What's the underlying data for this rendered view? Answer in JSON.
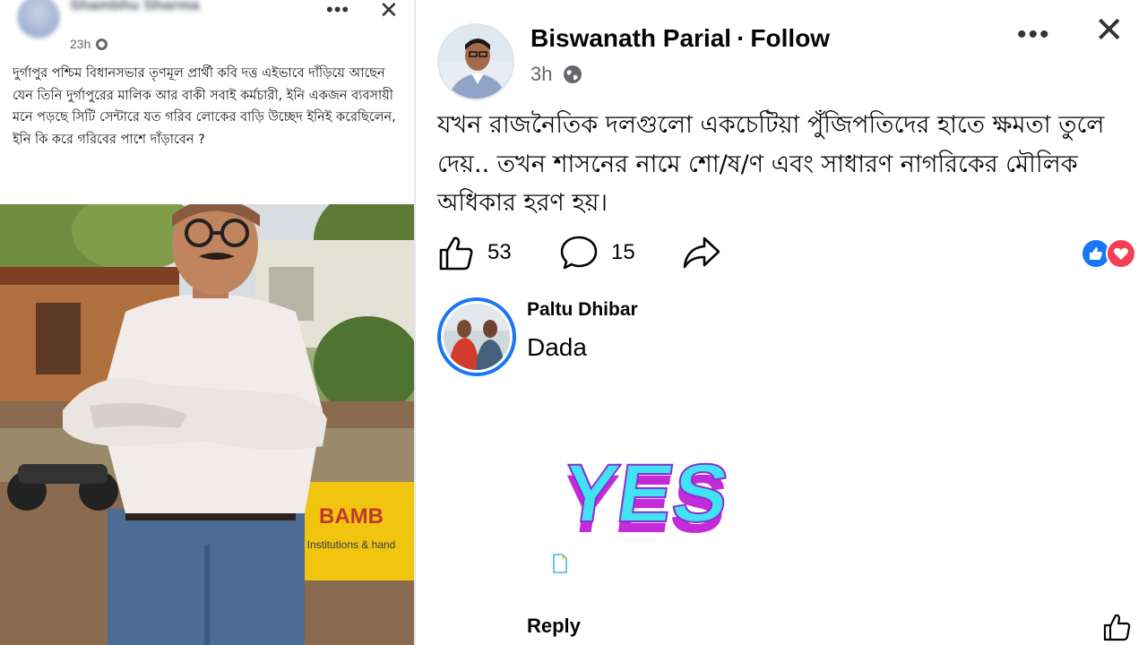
{
  "left_post": {
    "author_name": "Shambhu Sharma",
    "timestamp": "23h",
    "more_label": "•••",
    "close_label": "✕",
    "text": "দুর্গাপুর পশ্চিম বিধানসভার তৃণমূল প্রার্থী কবি দত্ত এইভাবে দাঁড়িয়ে আছেন যেন তিনি দুর্গাপুরের মালিক আর বাকী সবাই কর্মচারী, ইনি একজন ব্যবসায়ী মনে পড়ছে সিটি সেন্টারে যত গরিব লোকের বাড়ি উচ্ছেদ ইনিই করেছিলেন, ইনি কি করে গরিবের পাশে দাঁড়াবেন ?",
    "photo_sign": "BAMB",
    "photo_sign_sub": "Institutions & hand"
  },
  "right_post": {
    "author_name": "Biswanath Parial",
    "separator": "·",
    "follow_label": "Follow",
    "timestamp": "3h",
    "more_label": "•••",
    "close_label": "✕",
    "text": "যখন রাজনৈতিক দলগুলো একচেটিয়া পুঁজিপতিদের হাতে ক্ষমতা তুলে দেয়.. তখন শাসনের নামে শো/ষ/ণ  এবং সাধারণ নাগরিকের মৌলিক অধিকার হরণ হয়।",
    "like_count": "53",
    "comment_count": "15"
  },
  "comment": {
    "author_name": "Paltu Dhibar",
    "text": "Dada",
    "sticker_text": "YES",
    "reply_label": "Reply"
  },
  "colors": {
    "facebook_blue": "#1877f2",
    "love_red": "#f33e58",
    "secondary_text": "#65676b"
  }
}
